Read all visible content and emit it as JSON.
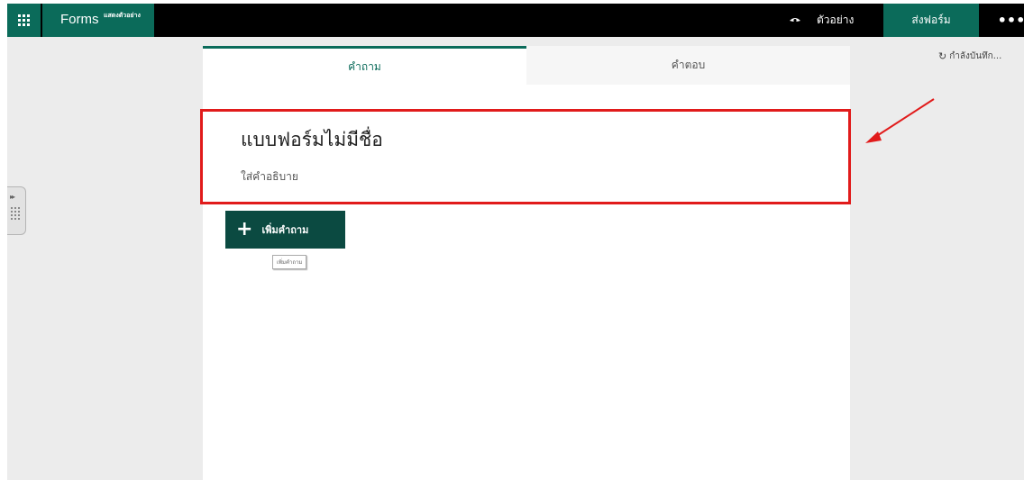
{
  "header": {
    "app_name": "Forms",
    "app_subtitle": "แสดงตัวอย่าง",
    "apps_icon": "waffle-grid-icon",
    "preview_label": "ตัวอย่าง",
    "preview_icon": "eye-icon",
    "send_label": "ส่งฟอร์ม",
    "more_label": "•••",
    "brand_color": "#0b6b5a"
  },
  "status": {
    "saving_label": "กำลังบันทึก...",
    "icon": "refresh-icon"
  },
  "side_panel": {
    "arrows": "▸▸"
  },
  "tabs": [
    {
      "label": "คำถาม",
      "active": true
    },
    {
      "label": "คำตอบ",
      "active": false
    }
  ],
  "form": {
    "title": "แบบฟอร์มไม่มีชื่อ",
    "description_placeholder": "ใส่คำอธิบาย",
    "add_question_label": "เพิ่มคำถาม",
    "add_question_tooltip": "เพิ่มคำถาม"
  },
  "annotation": {
    "highlight_color": "#e11b1b"
  }
}
